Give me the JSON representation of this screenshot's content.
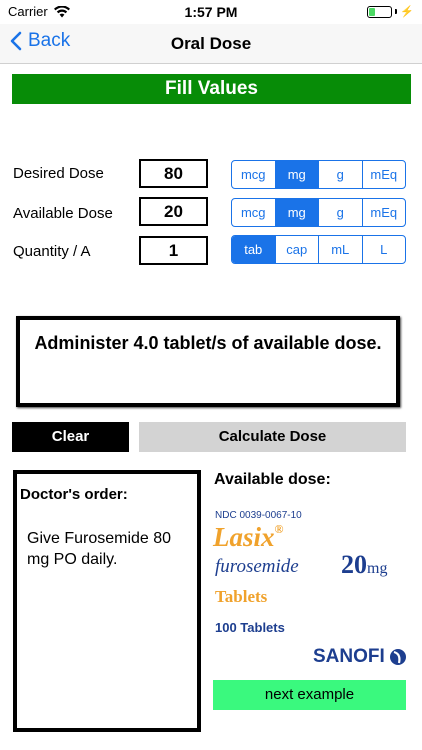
{
  "status": {
    "carrier": "Carrier",
    "time": "1:57 PM"
  },
  "nav": {
    "back_label": "Back",
    "title": "Oral Dose"
  },
  "header": {
    "fill_values": "Fill Values"
  },
  "rows": [
    {
      "label": "Desired Dose",
      "value": "80",
      "units": [
        "mcg",
        "mg",
        "g",
        "mEq"
      ],
      "selected": "mg"
    },
    {
      "label": "Available Dose",
      "value": "20",
      "units": [
        "mcg",
        "mg",
        "g",
        "mEq"
      ],
      "selected": "mg"
    },
    {
      "label": "Quantity / A",
      "value": "1",
      "units": [
        "tab",
        "cap",
        "mL",
        "L"
      ],
      "selected": "tab"
    }
  ],
  "result": {
    "text": "Administer 4.0 tablet/s of available dose."
  },
  "buttons": {
    "clear": "Clear",
    "calculate": "Calculate Dose",
    "next": "next example"
  },
  "doctor_order": {
    "title": "Doctor's order:",
    "text": "Give Furosemide 80 mg PO daily."
  },
  "available": {
    "title": "Available dose:",
    "label": {
      "ndc": "NDC 0039-0067-10",
      "brand": "Lasix",
      "brand_mark": "®",
      "generic": "furosemide",
      "strength_value": "20",
      "strength_unit": "mg",
      "form": "Tablets",
      "count": "100 Tablets",
      "manufacturer": "SANOFI"
    }
  },
  "colors": {
    "accent": "#1a73e8",
    "header_green": "#078c07",
    "next_green": "#3af97e"
  }
}
